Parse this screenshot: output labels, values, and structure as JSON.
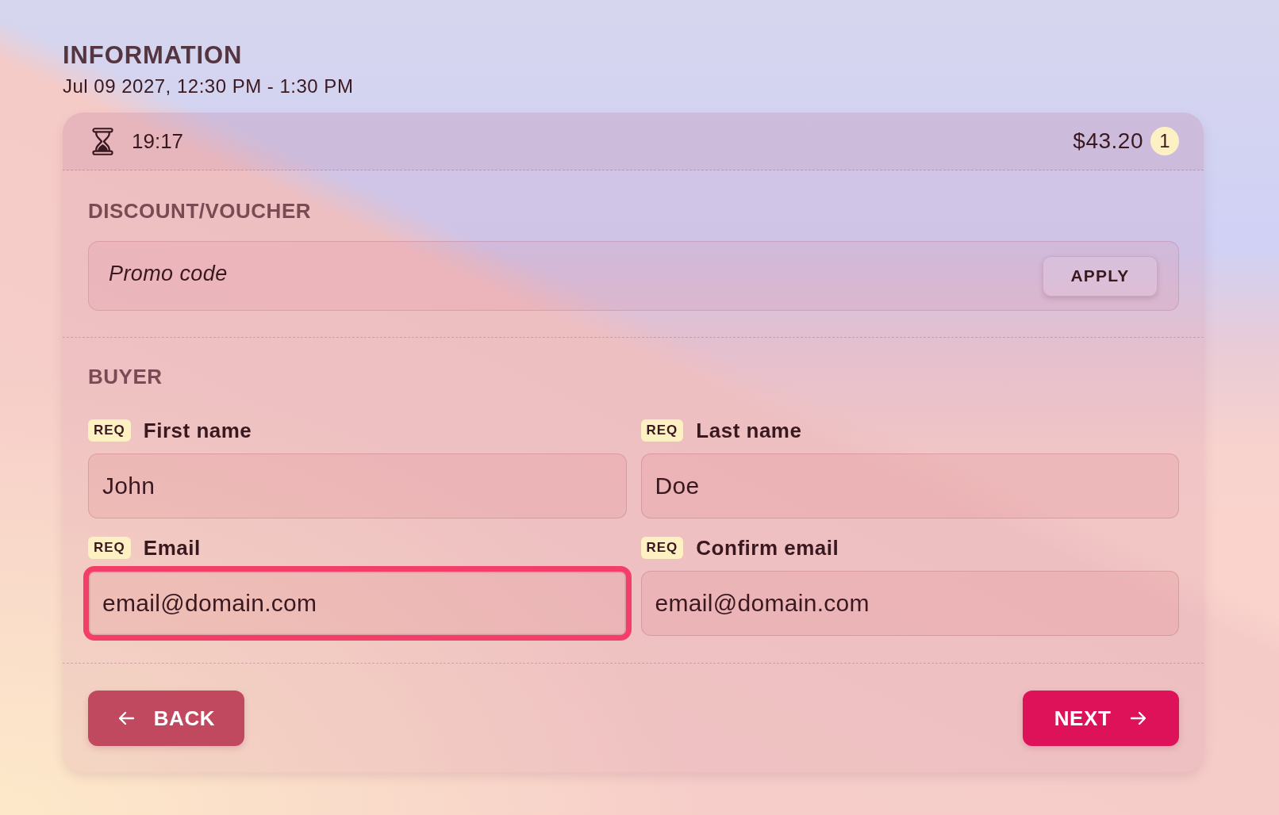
{
  "header": {
    "title": "INFORMATION",
    "datetime": "Jul 09 2027, 12:30 PM - 1:30 PM"
  },
  "cart_bar": {
    "timer": "19:17",
    "total": "$43.20",
    "item_count": "1"
  },
  "discount": {
    "heading": "DISCOUNT/VOUCHER",
    "promo_field": {
      "placeholder": "Promo code"
    },
    "apply_button": "APPLY"
  },
  "buyer": {
    "heading": "BUYER",
    "fields": [
      {
        "tag": "REQ",
        "label": "First name",
        "value": "John",
        "focused": false
      },
      {
        "tag": "REQ",
        "label": "Last name",
        "value": "Doe",
        "focused": false
      },
      {
        "tag": "REQ",
        "label": "Email",
        "value": "email@domain.com",
        "focused": true
      },
      {
        "tag": "REQ",
        "label": "Confirm email",
        "value": "email@domain.com",
        "focused": false
      }
    ]
  },
  "navigation": {
    "back_button": "BACK",
    "next_button": "NEXT"
  }
}
